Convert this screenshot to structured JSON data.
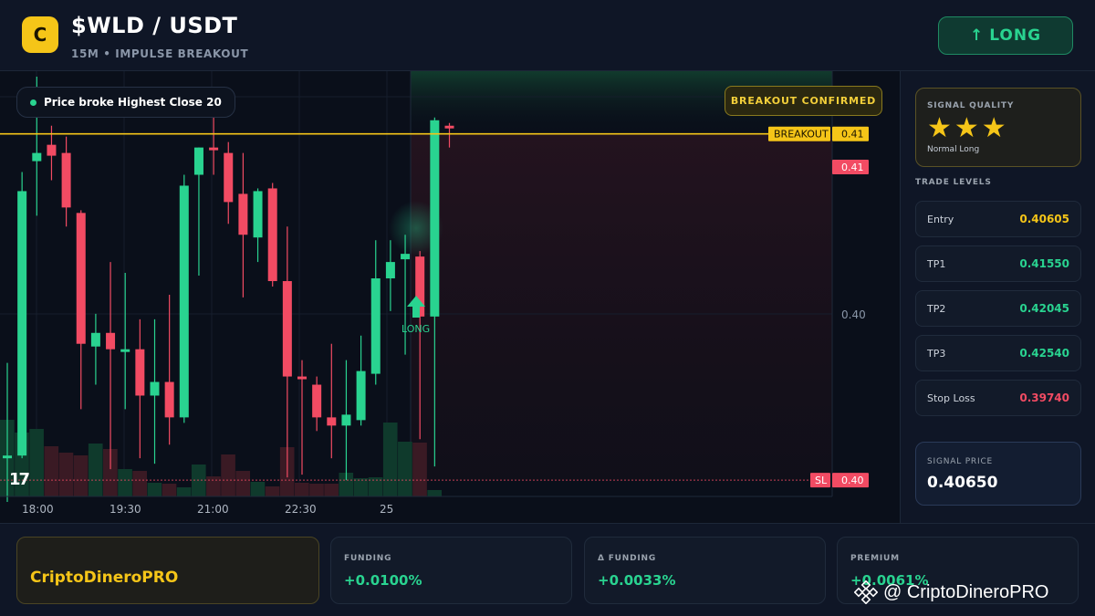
{
  "header": {
    "logo_letter": "C",
    "pair": "$WLD / USDT",
    "subtitle": "15M • IMPULSE BREAKOUT",
    "long_button": {
      "arrow": "↑",
      "label": "LONG"
    }
  },
  "chart": {
    "pill": "Price broke Highest Close 20",
    "confirmed": "BREAKOUT CONFIRMED",
    "long_marker_label": "LONG",
    "breakout_tag": "BREAKOUT",
    "breakout_value": "0.41",
    "last_price_value": "0.41",
    "sl_tag": "SL",
    "sl_value": "0.40",
    "axis_labels": [
      "0.41",
      "0.40"
    ],
    "time_labels": [
      "18:00",
      "19:30",
      "21:00",
      "22:30",
      "25"
    ],
    "tv_logo": "17",
    "colors": {
      "up": "#29d390",
      "down": "#f24b63",
      "breakout": "#f5c518",
      "sl": "#f24b63"
    }
  },
  "chart_data": {
    "type": "candlestick",
    "ylim": [
      0.3968,
      0.4124
    ],
    "breakout_level": 0.4101,
    "stop_loss_level": 0.3974,
    "candles": [
      {
        "o": 0.3982,
        "h": 0.4017,
        "l": 0.3966,
        "c": 0.3983
      },
      {
        "o": 0.3983,
        "h": 0.4087,
        "l": 0.3982,
        "c": 0.408
      },
      {
        "o": 0.4091,
        "h": 0.4122,
        "l": 0.4071,
        "c": 0.4094
      },
      {
        "o": 0.4097,
        "h": 0.4104,
        "l": 0.4084,
        "c": 0.4093
      },
      {
        "o": 0.4094,
        "h": 0.41,
        "l": 0.4067,
        "c": 0.4074
      },
      {
        "o": 0.4072,
        "h": 0.4073,
        "l": 0.4,
        "c": 0.4024
      },
      {
        "o": 0.4023,
        "h": 0.4035,
        "l": 0.4009,
        "c": 0.4028
      },
      {
        "o": 0.4028,
        "h": 0.4054,
        "l": 0.3978,
        "c": 0.4022
      },
      {
        "o": 0.4021,
        "h": 0.405,
        "l": 0.4,
        "c": 0.4022
      },
      {
        "o": 0.4022,
        "h": 0.4033,
        "l": 0.3982,
        "c": 0.4005
      },
      {
        "o": 0.4005,
        "h": 0.4033,
        "l": 0.398,
        "c": 0.401
      },
      {
        "o": 0.401,
        "h": 0.4042,
        "l": 0.3987,
        "c": 0.3997
      },
      {
        "o": 0.3997,
        "h": 0.4086,
        "l": 0.3995,
        "c": 0.4082
      },
      {
        "o": 0.4086,
        "h": 0.4096,
        "l": 0.4049,
        "c": 0.4096
      },
      {
        "o": 0.4096,
        "h": 0.4108,
        "l": 0.4086,
        "c": 0.4095
      },
      {
        "o": 0.4094,
        "h": 0.4098,
        "l": 0.4068,
        "c": 0.4076
      },
      {
        "o": 0.4079,
        "h": 0.4094,
        "l": 0.4041,
        "c": 0.4064
      },
      {
        "o": 0.4063,
        "h": 0.4081,
        "l": 0.4054,
        "c": 0.408
      },
      {
        "o": 0.4081,
        "h": 0.4083,
        "l": 0.4045,
        "c": 0.4047
      },
      {
        "o": 0.4047,
        "h": 0.4067,
        "l": 0.3975,
        "c": 0.4012
      },
      {
        "o": 0.4012,
        "h": 0.4018,
        "l": 0.3976,
        "c": 0.4011
      },
      {
        "o": 0.4009,
        "h": 0.4012,
        "l": 0.3992,
        "c": 0.3997
      },
      {
        "o": 0.3997,
        "h": 0.4024,
        "l": 0.3982,
        "c": 0.3994
      },
      {
        "o": 0.3994,
        "h": 0.4018,
        "l": 0.3974,
        "c": 0.3998
      },
      {
        "o": 0.3996,
        "h": 0.4027,
        "l": 0.3994,
        "c": 0.4014
      },
      {
        "o": 0.4013,
        "h": 0.4062,
        "l": 0.4009,
        "c": 0.4048
      },
      {
        "o": 0.4048,
        "h": 0.4062,
        "l": 0.4036,
        "c": 0.4054
      },
      {
        "o": 0.4055,
        "h": 0.4064,
        "l": 0.402,
        "c": 0.4057
      },
      {
        "o": 0.4056,
        "h": 0.4058,
        "l": 0.3989,
        "c": 0.4034
      },
      {
        "o": 0.4034,
        "h": 0.4107,
        "l": 0.3979,
        "c": 0.4106
      },
      {
        "o": 0.4104,
        "h": 0.4105,
        "l": 0.4096,
        "c": 0.4103
      }
    ],
    "volume": [
      0.84,
      0.7,
      0.74,
      0.55,
      0.48,
      0.45,
      0.58,
      0.52,
      0.3,
      0.28,
      0.15,
      0.14,
      0.1,
      0.35,
      0.22,
      0.46,
      0.28,
      0.16,
      0.11,
      0.54,
      0.15,
      0.14,
      0.14,
      0.26,
      0.2,
      0.21,
      0.81,
      0.6,
      0.59,
      0.07,
      0.0
    ]
  },
  "sidebar": {
    "quality_label": "SIGNAL QUALITY",
    "stars": "★★★",
    "quality_note": "Normal Long",
    "levels_title": "TRADE LEVELS",
    "levels": [
      {
        "name": "Entry",
        "value": "0.40605",
        "color": "#f5c518"
      },
      {
        "name": "TP1",
        "value": "0.41550",
        "color": "#29d390"
      },
      {
        "name": "TP2",
        "value": "0.42045",
        "color": "#29d390"
      },
      {
        "name": "TP3",
        "value": "0.42540",
        "color": "#29d390"
      },
      {
        "name": "Stop Loss",
        "value": "0.39740",
        "color": "#f24b63"
      }
    ],
    "signal_price_label": "SIGNAL PRICE",
    "signal_price": "0.40650"
  },
  "bottom": {
    "brand": "CriptoDineroPRO",
    "stats": [
      {
        "label": "FUNDING",
        "value": "+0.0100%"
      },
      {
        "label": "Δ FUNDING",
        "value": "+0.0033%"
      },
      {
        "label": "PREMIUM",
        "value": "+0.0061%"
      }
    ],
    "watermark": "@ CriptoDineroPRO"
  }
}
